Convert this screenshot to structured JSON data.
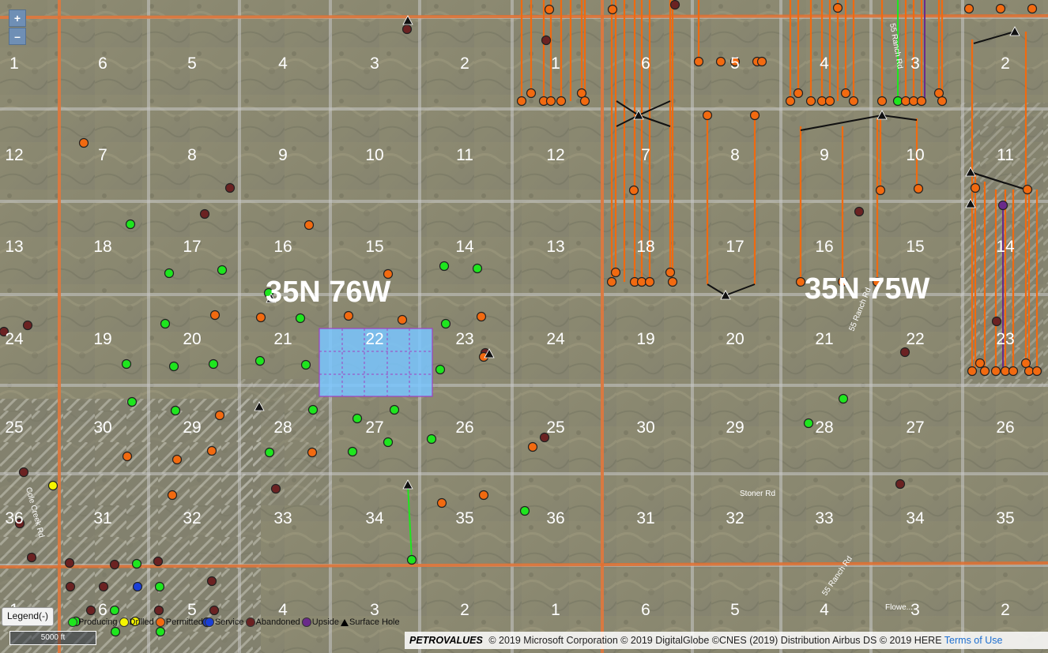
{
  "zoom": {
    "in_label": "+",
    "out_label": "–"
  },
  "townships": [
    "35N 76W",
    "35N 75W"
  ],
  "sections": [
    "1",
    "6",
    "5",
    "4",
    "3",
    "2",
    "1",
    "6",
    "5",
    "4",
    "3",
    "2",
    "12",
    "7",
    "8",
    "9",
    "10",
    "11",
    "12",
    "7",
    "8",
    "9",
    "10",
    "11",
    "13",
    "18",
    "17",
    "16",
    "15",
    "14",
    "13",
    "18",
    "17",
    "16",
    "15",
    "14",
    "24",
    "19",
    "20",
    "21",
    "22",
    "23",
    "24",
    "19",
    "20",
    "21",
    "22",
    "23",
    "25",
    "30",
    "29",
    "28",
    "27",
    "26",
    "25",
    "30",
    "29",
    "28",
    "27",
    "26",
    "36",
    "31",
    "32",
    "33",
    "34",
    "35",
    "36",
    "31",
    "32",
    "33",
    "34",
    "35",
    "1",
    "6",
    "5",
    "4",
    "3",
    "2",
    "1",
    "6",
    "5",
    "4",
    "3",
    "2"
  ],
  "roads": [
    "Stoner Rd",
    "55 Ranch Rd",
    "55 Ranch Rd",
    "55 Ranch Rd",
    "Cole Creek Rd",
    "Flowe..."
  ],
  "legend": {
    "button": "Legend(-)",
    "items": [
      {
        "label": "Producing",
        "color": "#1ee61e"
      },
      {
        "label": "Drilled",
        "color": "#f5f500"
      },
      {
        "label": "Permitted",
        "color": "#f26a10"
      },
      {
        "label": "Service",
        "color": "#1a3fd6"
      },
      {
        "label": "Abandoned",
        "color": "#6b2222"
      },
      {
        "label": "Upside",
        "color": "#6a2a8a"
      },
      {
        "label": "Surface Hole",
        "color": "#000000"
      }
    ]
  },
  "scale_label": "5000 ft",
  "attribution": {
    "logo": "PETROVALUES",
    "text": "© 2019 Microsoft Corporation © 2019 DigitalGlobe ©CNES (2019) Distribution Airbus DS © 2019 HERE",
    "link": "Terms of Use"
  },
  "colors": {
    "section_line": "#c8c8c8",
    "township_line": "#e07030",
    "selection_fill": "#79c5ff",
    "selection_border": "#a040c0"
  }
}
